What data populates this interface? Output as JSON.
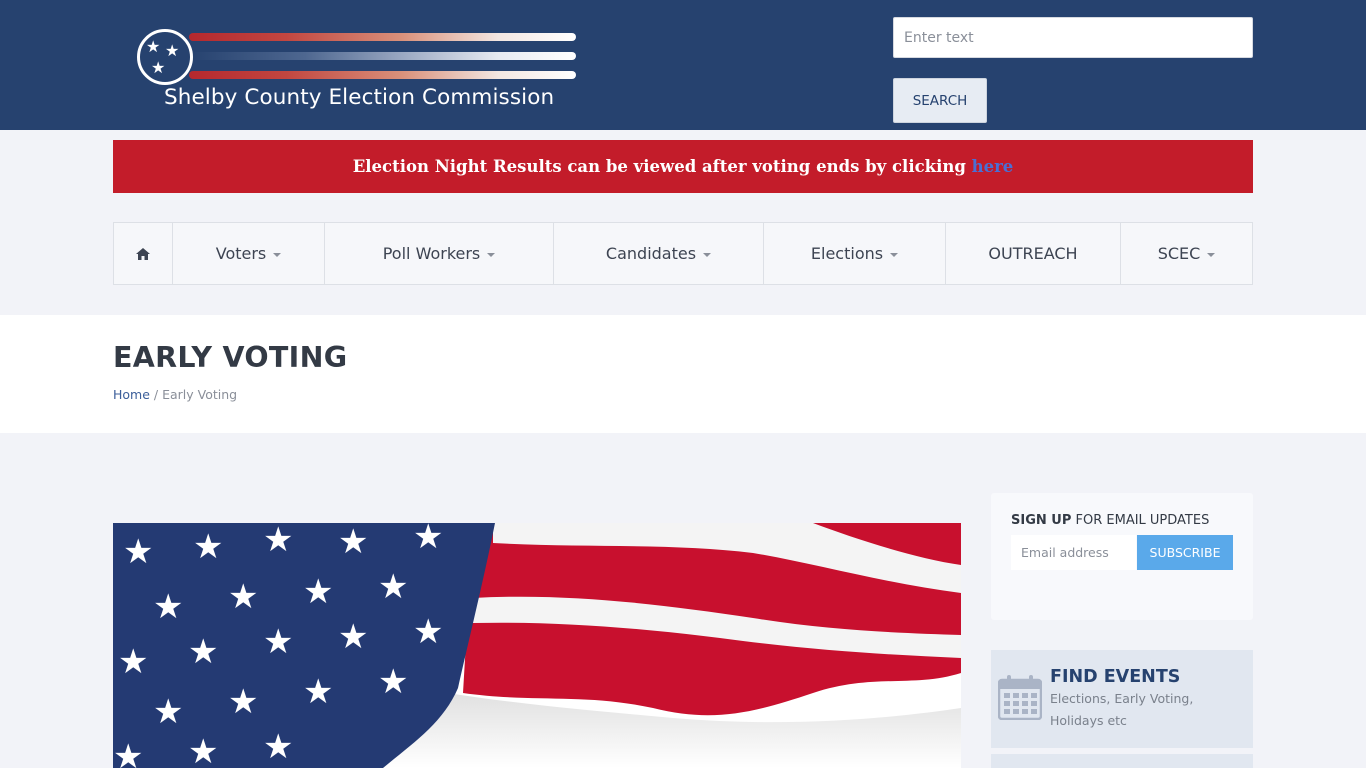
{
  "header": {
    "logo_text": "Shelby County Election Commission",
    "search_placeholder": "Enter text",
    "search_button": "SEARCH"
  },
  "alert": {
    "text": "Election Night Results can be viewed after voting ends by clicking ",
    "link_text": "here"
  },
  "nav": {
    "items": [
      {
        "label": "",
        "icon": "home-icon",
        "dropdown": false
      },
      {
        "label": "Voters",
        "dropdown": true
      },
      {
        "label": "Poll Workers",
        "dropdown": true
      },
      {
        "label": "Candidates",
        "dropdown": true
      },
      {
        "label": "Elections",
        "dropdown": true
      },
      {
        "label": "OUTREACH",
        "dropdown": false
      },
      {
        "label": "SCEC",
        "dropdown": true
      }
    ]
  },
  "page": {
    "title": "EARLY VOTING",
    "breadcrumb_home": "Home",
    "breadcrumb_sep": " / ",
    "breadcrumb_current": "Early Voting"
  },
  "signup": {
    "title_bold": "SIGN UP",
    "title_rest": " FOR EMAIL UPDATES",
    "email_placeholder": "Email address",
    "subscribe_button": "SUBSCRIBE"
  },
  "events": {
    "title": "FIND EVENTS",
    "description": "Elections, Early Voting, Holidays etc"
  },
  "colors": {
    "header_bg": "#26426f",
    "alert_bg": "#c31c2a",
    "accent": "#5aa9ea"
  }
}
